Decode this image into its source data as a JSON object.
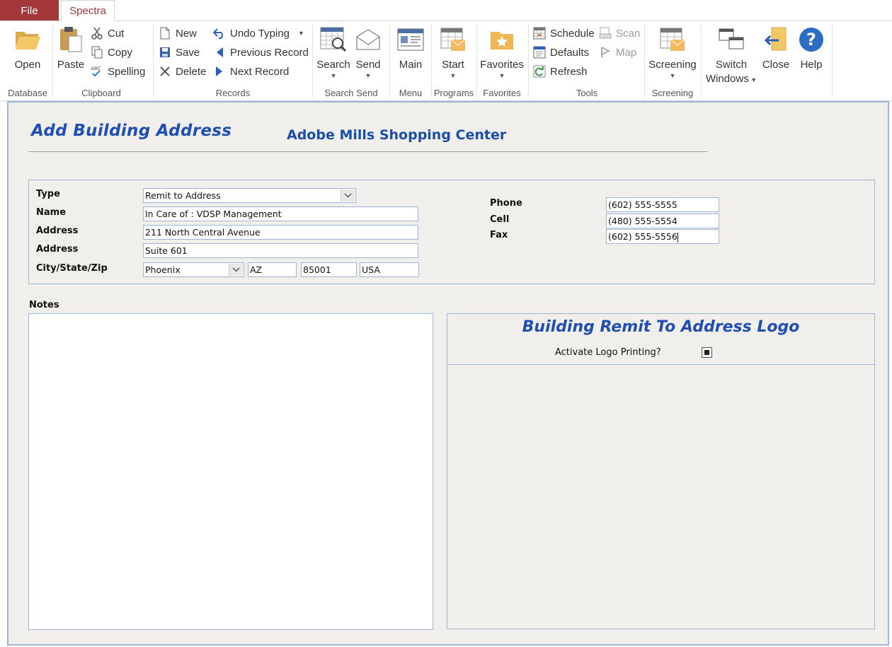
{
  "tabs": {
    "file": "File",
    "spectra": "Spectra"
  },
  "ribbon": {
    "database": {
      "label": "Database",
      "open": "Open"
    },
    "clipboard": {
      "label": "Clipboard",
      "paste": "Paste",
      "cut": "Cut",
      "copy": "Copy",
      "spelling": "Spelling"
    },
    "records": {
      "label": "Records",
      "new": "New",
      "save": "Save",
      "delete": "Delete",
      "undo": "Undo Typing",
      "previous": "Previous Record",
      "next": "Next Record"
    },
    "search_send": {
      "label": "Search Send",
      "search": "Search",
      "send": "Send"
    },
    "menu": {
      "label": "Menu",
      "main": "Main"
    },
    "programs": {
      "label": "Programs",
      "start": "Start"
    },
    "favorites": {
      "label": "Favorites",
      "favorites": "Favorites"
    },
    "tools": {
      "label": "Tools",
      "schedule": "Schedule",
      "defaults": "Defaults",
      "refresh": "Refresh",
      "scan": "Scan",
      "map": "Map"
    },
    "screening": {
      "label": "Screening",
      "screening": "Screening"
    },
    "window": {
      "switch_line1": "Switch",
      "switch_line2": "Windows",
      "close": "Close",
      "help": "Help"
    }
  },
  "form": {
    "title": "Add Building Address",
    "building_name": "Adobe Mills Shopping Center",
    "labels": {
      "type": "Type",
      "name": "Name",
      "address1": "Address",
      "address2": "Address",
      "city_state_zip": "City/State/Zip",
      "phone": "Phone",
      "cell": "Cell",
      "fax": "Fax",
      "notes": "Notes"
    },
    "values": {
      "type": "Remit to Address",
      "name": "In Care of : VDSP Management",
      "address1": "211 North Central Avenue",
      "address2": "Suite 601",
      "city": "Phoenix",
      "state": "AZ",
      "zip": "85001",
      "country": "USA",
      "phone": "(602) 555-5555",
      "cell": "(480) 555-5554",
      "fax": "(602) 555-5556",
      "notes": ""
    },
    "logo": {
      "title": "Building Remit To Address Logo",
      "activate_label": "Activate Logo Printing?",
      "activate_checked": true
    }
  },
  "colors": {
    "file_tab": "#a4373a",
    "title_blue": "#1f4fb5",
    "field_border": "#9eb6d3",
    "form_bg": "#f1efeb"
  },
  "icons": [
    "folder-open-icon",
    "paste-icon",
    "scissors-icon",
    "copy-icon",
    "spelling-icon",
    "new-doc-icon",
    "save-disk-icon",
    "delete-x-icon",
    "undo-icon",
    "previous-arrow-icon",
    "next-arrow-icon",
    "search-grid-icon",
    "envelope-icon",
    "main-menu-icon",
    "start-icon",
    "favorites-star-icon",
    "schedule-icon",
    "defaults-icon",
    "refresh-icon",
    "scan-icon",
    "map-icon",
    "screening-icon",
    "switch-windows-icon",
    "close-door-icon",
    "help-icon"
  ]
}
